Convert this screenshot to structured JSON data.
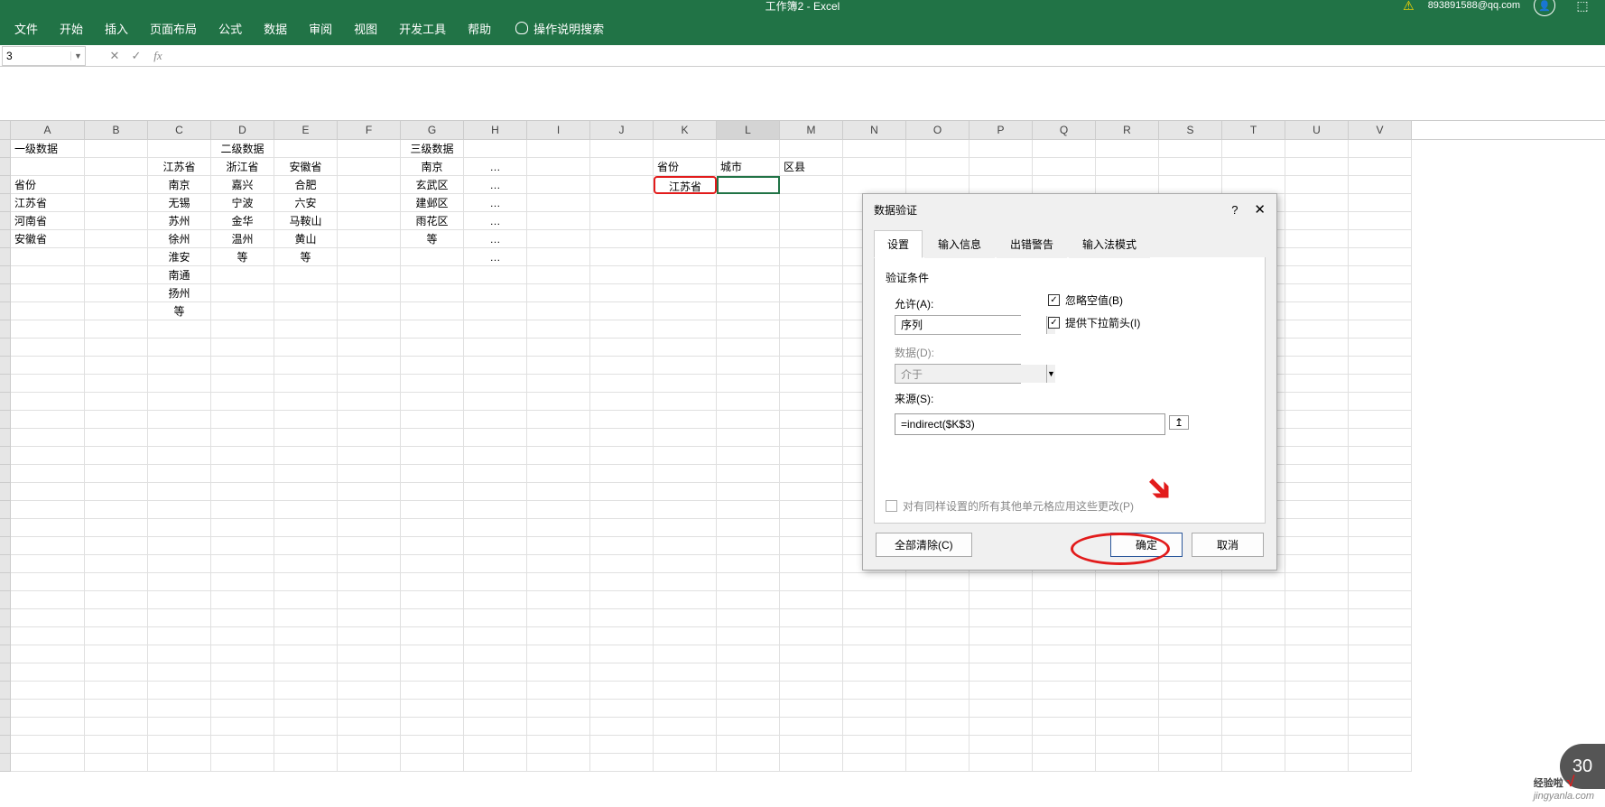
{
  "title_bar": {
    "doc_title": "工作簿2 - Excel",
    "user_email": "893891588@qq.com"
  },
  "ribbon": {
    "tabs": [
      "文件",
      "开始",
      "插入",
      "页面布局",
      "公式",
      "数据",
      "审阅",
      "视图",
      "开发工具",
      "帮助"
    ],
    "search": "操作说明搜索"
  },
  "namebox": "3",
  "columns": [
    "A",
    "B",
    "C",
    "D",
    "E",
    "F",
    "G",
    "H",
    "I",
    "J",
    "K",
    "L",
    "M",
    "N",
    "O",
    "P",
    "Q",
    "R",
    "S",
    "T",
    "U",
    "V"
  ],
  "cells": {
    "A1": "一级数据",
    "D1": "二级数据",
    "G1": "三级数据",
    "C2": "江苏省",
    "D2": "浙江省",
    "E2": "安徽省",
    "G2": "南京",
    "H2": "…",
    "K2": "省份",
    "L2": "城市",
    "M2": "区县",
    "A3": "省份",
    "C3": "南京",
    "D3": "嘉兴",
    "E3": "合肥",
    "G3": "玄武区",
    "H3": "…",
    "K3": "江苏省",
    "A4": "江苏省",
    "C4": "无锡",
    "D4": "宁波",
    "E4": "六安",
    "G4": "建邺区",
    "H4": "…",
    "A5": "河南省",
    "C5": "苏州",
    "D5": "金华",
    "E5": "马鞍山",
    "G5": "雨花区",
    "H5": "…",
    "A6": "安徽省",
    "C6": "徐州",
    "D6": "温州",
    "E6": "黄山",
    "G6": "等",
    "H6": "…",
    "C7": "淮安",
    "D7": "等",
    "E7": "等",
    "H7": "…",
    "C8": "南通",
    "C9": "扬州",
    "C10": "等"
  },
  "dialog": {
    "title": "数据验证",
    "help": "?",
    "tabs": [
      "设置",
      "输入信息",
      "出错警告",
      "输入法模式"
    ],
    "sect": "验证条件",
    "allow_lbl": "允许(A):",
    "allow_val": "序列",
    "data_lbl": "数据(D):",
    "data_val": "介于",
    "ignore": "忽略空值(B)",
    "dropdown": "提供下拉箭头(I)",
    "source_lbl": "来源(S):",
    "source_val": "=indirect($K$3)",
    "apply": "对有同样设置的所有其他单元格应用这些更改(P)",
    "clear": "全部清除(C)",
    "ok": "确定",
    "cancel": "取消"
  },
  "watermark": {
    "brand": "经验啦",
    "url": "jingyanla.com"
  },
  "countdown": "30"
}
